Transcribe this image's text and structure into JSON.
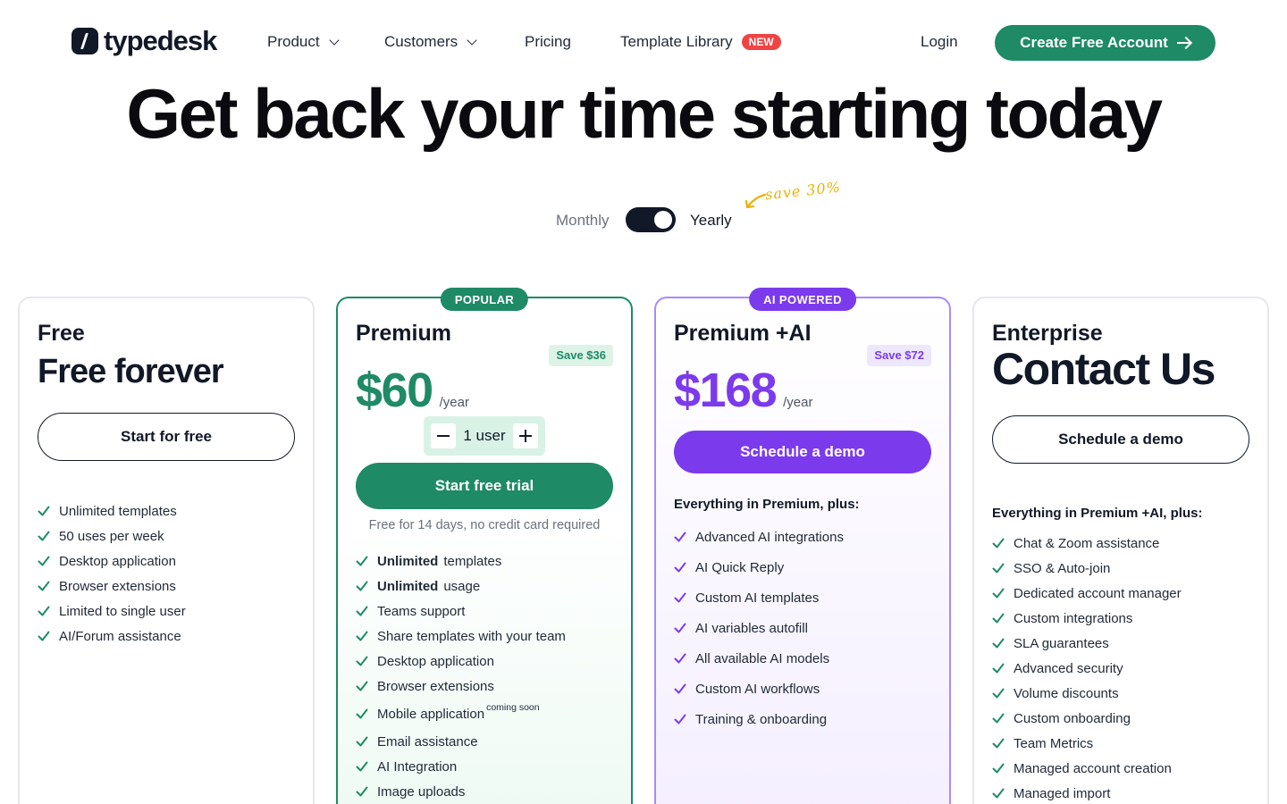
{
  "nav": {
    "logo": "typedesk",
    "product": "Product",
    "customers": "Customers",
    "pricing": "Pricing",
    "template_library": "Template Library",
    "new_badge": "NEW",
    "login": "Login",
    "cta": "Create Free Account"
  },
  "hero": {
    "title_start": "Get back your time starting",
    "title_highlight": "today"
  },
  "billing": {
    "monthly": "Monthly",
    "yearly": "Yearly",
    "selected": "Yearly",
    "save_note": "save 30%"
  },
  "colors": {
    "accent_green": "#1e8a66",
    "accent_purple": "#7c3aed",
    "highlight_yellow": "#fbbf24",
    "new_badge_red": "#ef4444"
  },
  "plans": {
    "free": {
      "name": "Free",
      "subtitle": "Free forever",
      "button": "Start for free",
      "features": [
        "Unlimited templates",
        "50 uses per week",
        "Desktop application",
        "Browser extensions",
        "Limited to single user",
        "AI/Forum assistance"
      ]
    },
    "premium": {
      "ribbon": "POPULAR",
      "name": "Premium",
      "save": "Save $36",
      "price": "$60",
      "period": "/year",
      "users": "1 user",
      "button": "Start free trial",
      "note": "Free for 14 days, no credit card required",
      "features": [
        {
          "bold": "Unlimited",
          "text": "templates"
        },
        {
          "bold": "Unlimited",
          "text": "usage"
        },
        {
          "text": "Teams support"
        },
        {
          "text": "Share templates with your team"
        },
        {
          "text": "Desktop application"
        },
        {
          "text": "Browser extensions"
        },
        {
          "text": "Mobile application",
          "sup": "coming soon"
        },
        {
          "text": "Email assistance"
        },
        {
          "text": "AI Integration"
        },
        {
          "text": "Image uploads"
        }
      ]
    },
    "premium_ai": {
      "ribbon": "AI POWERED",
      "name": "Premium +AI",
      "save": "Save $72",
      "price": "$168",
      "period": "/year",
      "button": "Schedule a demo",
      "intro": "Everything in Premium, plus:",
      "features": [
        "Advanced AI integrations",
        "AI Quick Reply",
        "Custom AI templates",
        "AI variables autofill",
        "All available AI models",
        "Custom AI workflows",
        "Training & onboarding"
      ]
    },
    "enterprise": {
      "name": "Enterprise",
      "subtitle": "Contact Us",
      "button": "Schedule a demo",
      "intro": "Everything in Premium +AI, plus:",
      "features": [
        "Chat & Zoom assistance",
        "SSO & Auto-join",
        "Dedicated account manager",
        "Custom integrations",
        "SLA guarantees",
        "Advanced security",
        "Volume discounts",
        "Custom onboarding",
        "Team Metrics",
        "Managed account creation",
        "Managed import"
      ]
    }
  }
}
